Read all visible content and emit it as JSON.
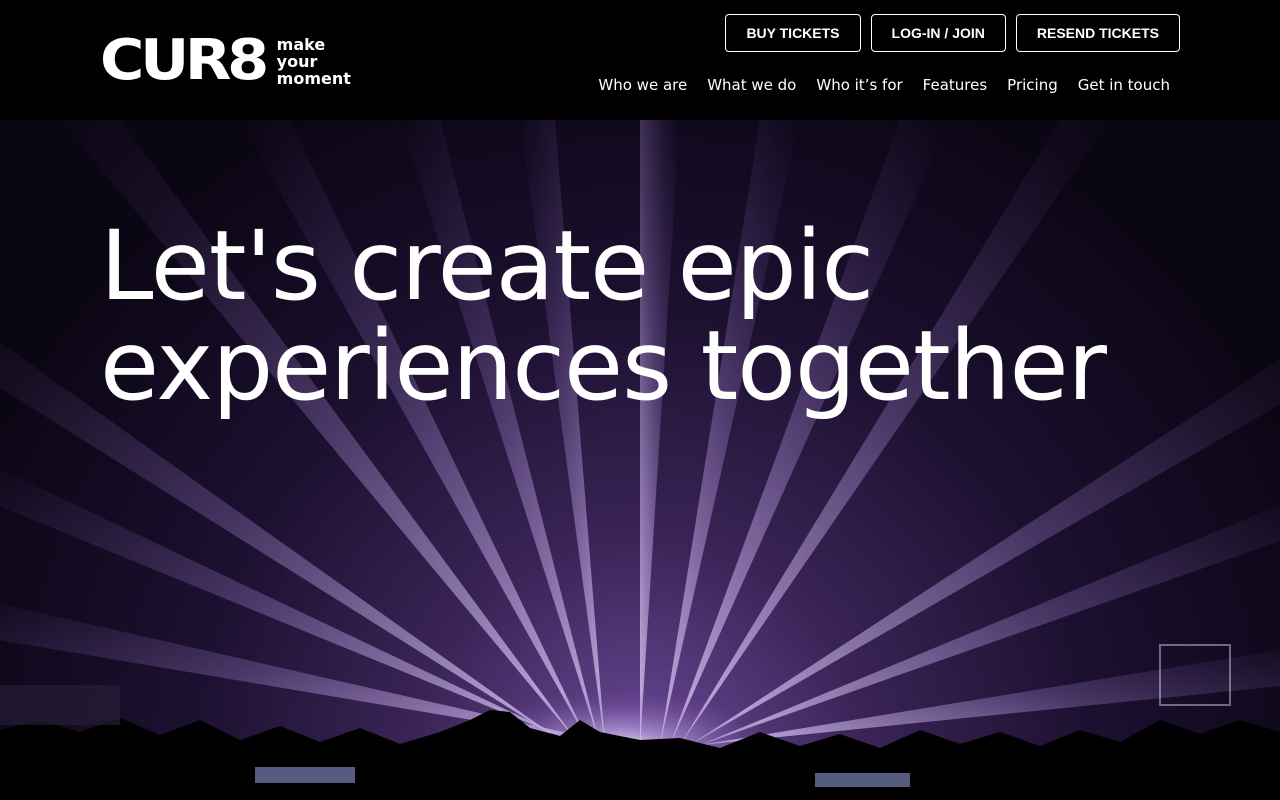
{
  "brand": {
    "logo_text": "CUR8",
    "tagline": [
      "make",
      "your",
      "moment"
    ]
  },
  "top_buttons": {
    "buy": "BUY TICKETS",
    "login": "LOG-IN / JOIN",
    "resend": "RESEND TICKETS"
  },
  "nav": {
    "items": [
      "Who we are",
      "What we do",
      "Who it’s for",
      "Features",
      "Pricing",
      "Get in touch"
    ]
  },
  "hero": {
    "line1": "Let's create epic",
    "line2": "experiences together"
  },
  "colors": {
    "header_bg": "#000000",
    "text": "#ffffff",
    "beam": "#b79be0"
  }
}
